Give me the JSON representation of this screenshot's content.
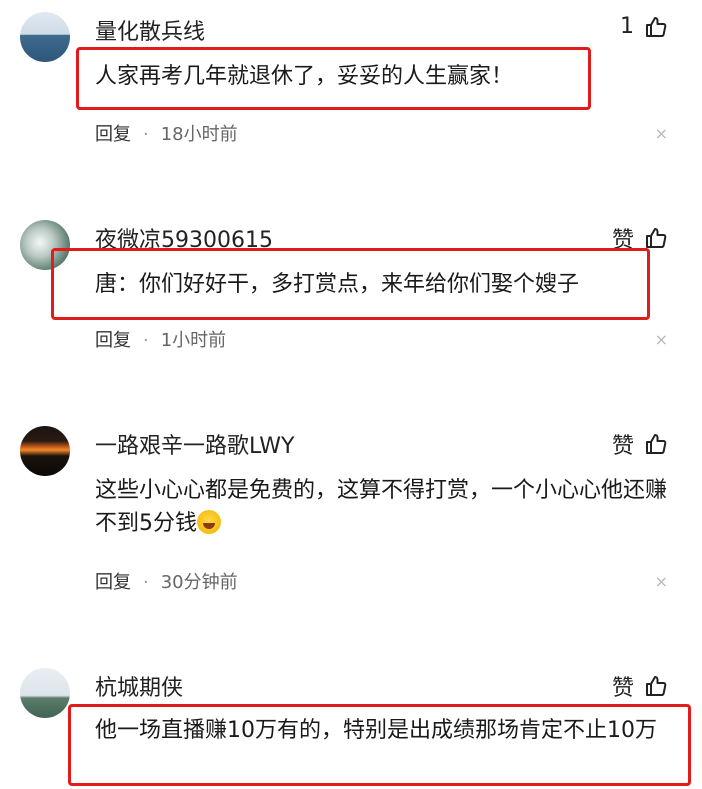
{
  "comments": [
    {
      "username": "量化散兵线",
      "like_label": "1",
      "text": "人家再考几年就退休了，妥妥的人生赢家！",
      "reply_label": "回复",
      "time": "18小时前",
      "close": "×"
    },
    {
      "username": "夜微凉59300615",
      "like_label": "赞",
      "text": "唐：你们好好干，多打赏点，来年给你们娶个嫂子",
      "reply_label": "回复",
      "time": "1小时前",
      "close": "×"
    },
    {
      "username": "一路艰辛一路歌LWY",
      "like_label": "赞",
      "text": "这些小心心都是免费的，这算不得打赏，一个小心心他还赚不到5分钱",
      "reply_label": "回复",
      "time": "30分钟前",
      "close": "×"
    },
    {
      "username": "杭城期侠",
      "like_label": "赞",
      "text": "他一场直播赚10万有的，特别是出成绩那场肯定不止10万"
    }
  ],
  "icons": {
    "thumb": "thumbs-up-icon",
    "close": "close-icon",
    "emoji": "laughing-emoji-icon"
  },
  "colors": {
    "highlight_box": "#e21b1b",
    "meta_text": "#666666"
  }
}
